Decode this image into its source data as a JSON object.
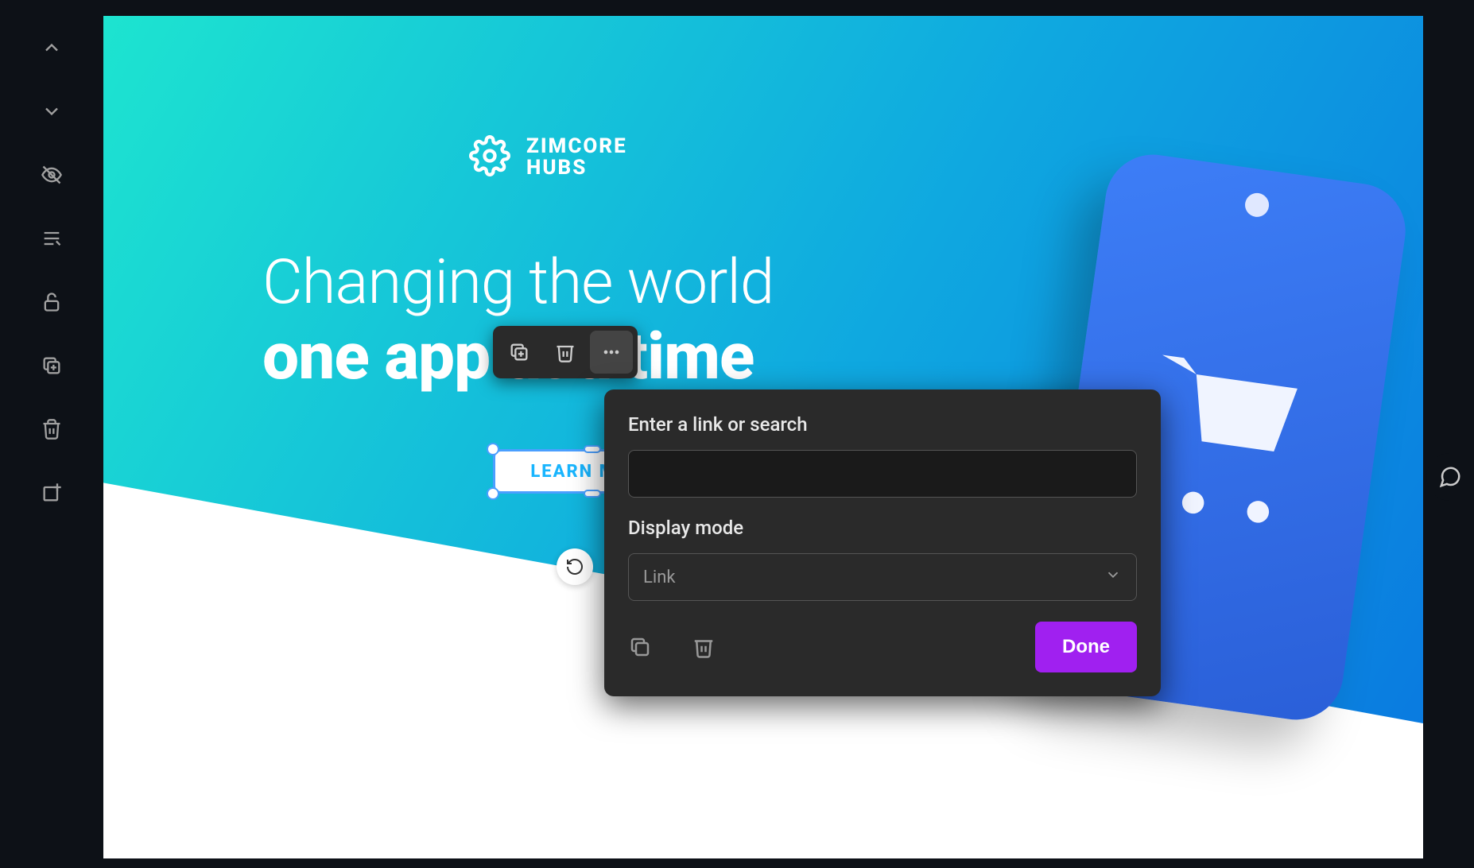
{
  "brand": {
    "line1": "ZIMCORE",
    "line2": "HUBS"
  },
  "headline": {
    "light": "Changing the world",
    "bold": "one app at a time"
  },
  "cta": {
    "label": "LEARN MORE"
  },
  "popover": {
    "link_label": "Enter a link or search",
    "display_label": "Display mode",
    "display_value": "Link",
    "done_label": "Done"
  },
  "colors": {
    "accent": "#a020f0",
    "gradient_start": "#1de4d0",
    "gradient_end": "#0a7be0",
    "dark_panel": "#2a2a2a"
  }
}
